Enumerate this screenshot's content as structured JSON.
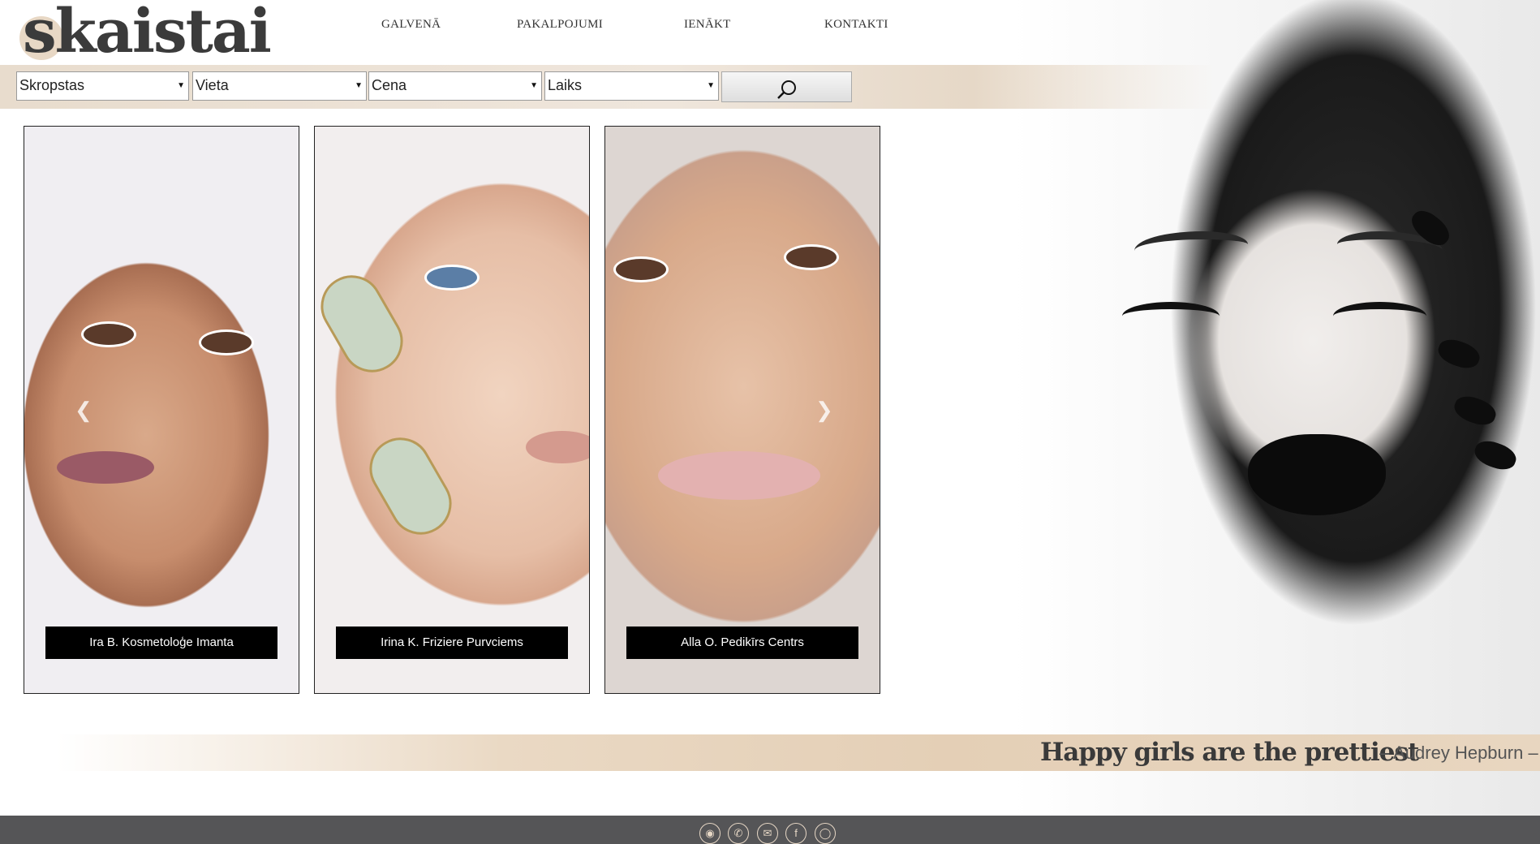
{
  "brand": {
    "logo_text": "skaistai"
  },
  "nav": {
    "items": [
      {
        "label": "GALVENĀ"
      },
      {
        "label": "PAKALPOJUMI"
      },
      {
        "label": "IENĀKT"
      },
      {
        "label": "KONTAKTI"
      }
    ]
  },
  "filters": {
    "service": "Skropstas",
    "location": "Vieta",
    "price": "Cena",
    "time": "Laiks",
    "search_icon": "search-icon"
  },
  "cards": [
    {
      "caption": "Ira B. Kosmetoloģe Imanta"
    },
    {
      "caption": "Irina K. Friziere Purvciems"
    },
    {
      "caption": "Alla O. Pedikīrs Centrs"
    }
  ],
  "carousel": {
    "prev_icon": "chevron-left-icon",
    "next_icon": "chevron-right-icon"
  },
  "quote": {
    "text": "Happy girls are the prettiest",
    "author": "– Audrey Hepburn –"
  },
  "footer": {
    "icons": [
      "map-pin-icon",
      "phone-icon",
      "mail-icon",
      "facebook-icon",
      "globe-icon"
    ]
  },
  "colors": {
    "accent": "#e6d7c5",
    "footer_bg": "#555557",
    "caption_bg": "#000000"
  }
}
